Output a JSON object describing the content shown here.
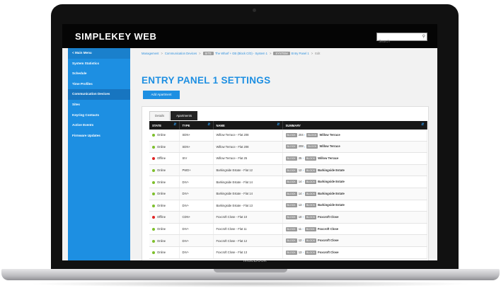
{
  "app": {
    "title": "SIMPLEKEY WEB"
  },
  "search": {
    "placeholder": "Search"
  },
  "device": {
    "brand": "MacBook"
  },
  "sidebar": {
    "items": [
      {
        "label": "< Main Menu"
      },
      {
        "label": "System Statistics"
      },
      {
        "label": "Schedule"
      },
      {
        "label": "Time Profiles"
      },
      {
        "label": "Communication Devices"
      },
      {
        "label": "Sites"
      },
      {
        "label": "Keyring Contacts"
      },
      {
        "label": "Active Events"
      },
      {
        "label": "Firmware Updates"
      }
    ],
    "active_index": 4
  },
  "breadcrumb": {
    "items": [
      "Management",
      "Communication Devices",
      "The Wharf + GB (Block C/D) - System 1",
      "Entry Panel 1",
      "Edit"
    ],
    "tags": [
      "SITE",
      "SYSTEM"
    ]
  },
  "page": {
    "title": "ENTRY PANEL 1 SETTINGS",
    "add_button": "Add Apartment"
  },
  "tabs": [
    {
      "label": "Details"
    },
    {
      "label": "Apartments"
    }
  ],
  "table": {
    "headers": [
      "STATE",
      "TYPE",
      "NAME",
      "SUMMARY"
    ],
    "rows": [
      {
        "state": "Online",
        "status": "online",
        "type": "SDN+",
        "name": "Willow Terrace - Flat 208",
        "code": "BLOCK",
        "num": "204",
        "tag": "BLOCK",
        "site": "Willow Terrace"
      },
      {
        "state": "Online",
        "status": "online",
        "type": "SDN+",
        "name": "Willow Terrace - Flat 208",
        "code": "BLOCK",
        "num": "208",
        "tag": "BLOCK",
        "site": "Willow Terrace"
      },
      {
        "state": "Offline",
        "status": "offline",
        "type": "SIV",
        "name": "Willow Terrace - Flat 25",
        "code": "BLOCK",
        "num": "25",
        "tag": "BLOCK",
        "site": "Willow Terrace"
      },
      {
        "state": "Online",
        "status": "online",
        "type": "PWD+",
        "name": "Barkingside Estate - Flat 12",
        "code": "BLOCK",
        "num": "12",
        "tag": "BLOCK",
        "site": "Barkingside Estate"
      },
      {
        "state": "Online",
        "status": "online",
        "type": "DIV+",
        "name": "Barkingside Estate - Flat 14",
        "code": "BLOCK",
        "num": "14",
        "tag": "BLOCK",
        "site": "Barkingside Estate"
      },
      {
        "state": "Online",
        "status": "online",
        "type": "DIV+",
        "name": "Barkingside Estate - Flat 14",
        "code": "BLOCK",
        "num": "14",
        "tag": "BLOCK",
        "site": "Barkingside Estate"
      },
      {
        "state": "Online",
        "status": "online",
        "type": "DIV+",
        "name": "Barkingside Estate - Flat 13",
        "code": "BLOCK",
        "num": "13",
        "tag": "BLOCK",
        "site": "Barkingside Estate"
      },
      {
        "state": "Offline",
        "status": "offline",
        "type": "CDN+",
        "name": "Foxcroft Close - Flat 10",
        "code": "BLOCK",
        "num": "10",
        "tag": "BLOCK",
        "site": "Foxcroft Close"
      },
      {
        "state": "Online",
        "status": "online",
        "type": "DIV+",
        "name": "Foxcroft Close - Flat 11",
        "code": "BLOCK",
        "num": "11",
        "tag": "BLOCK",
        "site": "Foxcroft Close"
      },
      {
        "state": "Online",
        "status": "online",
        "type": "DIV+",
        "name": "Foxcroft Close - Flat 12",
        "code": "BLOCK",
        "num": "12",
        "tag": "BLOCK",
        "site": "Foxcroft Close"
      },
      {
        "state": "Online",
        "status": "online",
        "type": "DIV+",
        "name": "Foxcroft Close - Flat 13",
        "code": "BLOCK",
        "num": "13",
        "tag": "BLOCK",
        "site": "Foxcroft Close"
      }
    ]
  },
  "colors": {
    "accent": "#1d8fe2",
    "online": "#7dbf2b",
    "offline": "#e02424",
    "header_bg": "#181818"
  }
}
